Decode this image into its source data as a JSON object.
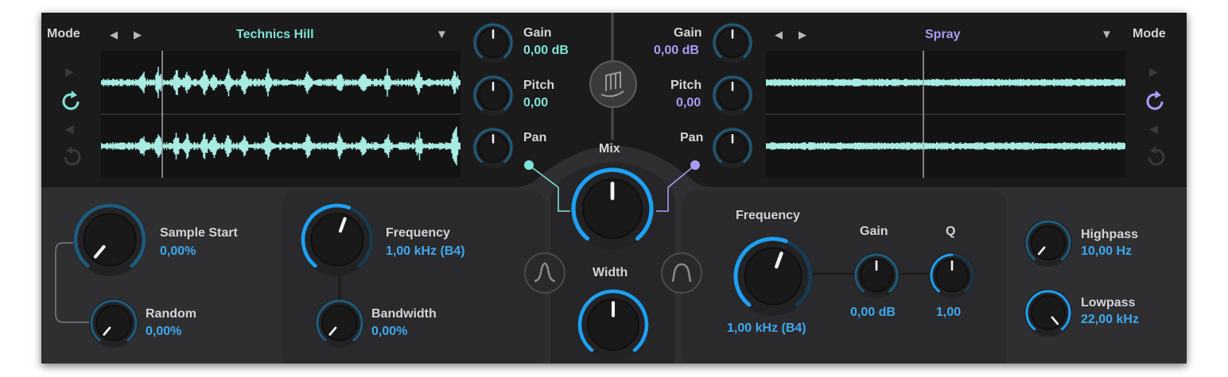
{
  "left": {
    "mode_label": "Mode",
    "preset_name": "Technics Hill",
    "gain_label": "Gain",
    "gain_value": "0,00 dB",
    "pitch_label": "Pitch",
    "pitch_value": "0,00",
    "pan_label": "Pan"
  },
  "right": {
    "mode_label": "Mode",
    "preset_name": "Spray",
    "gain_label": "Gain",
    "gain_value": "0,00 dB",
    "pitch_label": "Pitch",
    "pitch_value": "0,00",
    "pan_label": "Pan"
  },
  "center": {
    "mix_label": "Mix",
    "width_label": "Width"
  },
  "sample": {
    "start_label": "Sample Start",
    "start_value": "0,00%",
    "random_label": "Random",
    "random_value": "0,00%"
  },
  "filter_left": {
    "frequency_label": "Frequency",
    "frequency_value": "1,00 kHz (B4)",
    "bandwidth_label": "Bandwidth",
    "bandwidth_value": "0,00%"
  },
  "eq": {
    "frequency_label": "Frequency",
    "frequency_value": "1,00 kHz (B4)",
    "gain_label": "Gain",
    "gain_value": "0,00 dB",
    "q_label": "Q",
    "q_value": "1,00"
  },
  "output": {
    "highpass_label": "Highpass",
    "highpass_value": "10,00 Hz",
    "lowpass_label": "Lowpass",
    "lowpass_value": "22,00 kHz"
  },
  "colors": {
    "left_accent": "#7fe3d6",
    "right_accent": "#a99cf2",
    "value_blue": "#3ea8ee",
    "top_panel": "#1b1b1c",
    "bottom_panel": "#2f2f31"
  },
  "icons": {
    "prev": "triangle-left-icon",
    "next": "triangle-right-icon",
    "dropdown": "triangle-down-icon",
    "play": "play-icon",
    "loop": "loop-icon",
    "reverse": "reverse-icon",
    "reverse_loop": "reverse-loop-icon",
    "center_logo": "music-notes-icon",
    "filter_shape": "bell-curve-icon"
  }
}
